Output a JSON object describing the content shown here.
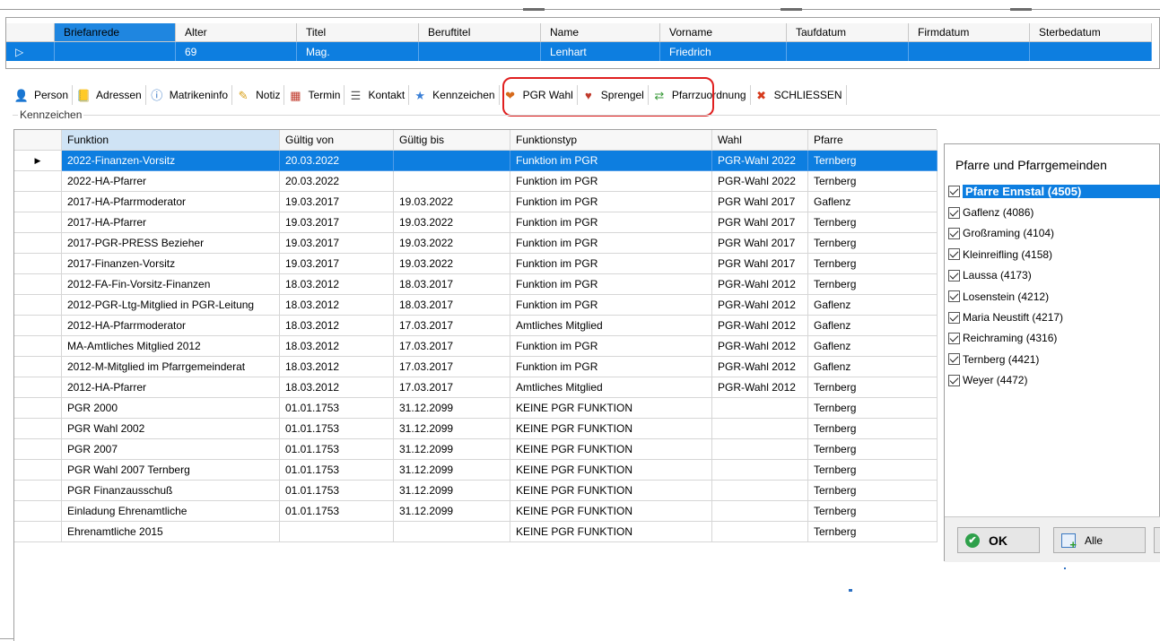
{
  "top_grid": {
    "headers": [
      "",
      "Briefanrede",
      "Alter",
      "Titel",
      "Beruftitel",
      "Name",
      "Vorname",
      "Taufdatum",
      "Firmdatum",
      "Sterbedatum"
    ],
    "row": [
      "▷",
      "",
      "69",
      "Mag.",
      "",
      "Lenhart",
      "Friedrich",
      "",
      "",
      ""
    ]
  },
  "tabs": [
    {
      "label": "Person",
      "icon": "person-icon",
      "glyph": "👤",
      "color": "#c46a1c"
    },
    {
      "label": "Adressen",
      "icon": "address-book-icon",
      "glyph": "📒",
      "color": "#c9a227"
    },
    {
      "label": "Matrikeninfo",
      "icon": "info-icon",
      "glyph": "ⓘ",
      "color": "#2b6fc2"
    },
    {
      "label": "Notiz",
      "icon": "note-icon",
      "glyph": "✎",
      "color": "#d9a11a"
    },
    {
      "label": "Termin",
      "icon": "calendar-icon",
      "glyph": "▦",
      "color": "#c0392b"
    },
    {
      "label": "Kontakt",
      "icon": "contact-icon",
      "glyph": "☰",
      "color": "#555555"
    },
    {
      "label": "Kennzeichen",
      "icon": "star-icon",
      "glyph": "★",
      "color": "#3a7fd6"
    },
    {
      "label": "PGR Wahl",
      "icon": "vote-icon",
      "glyph": "❤",
      "color": "#d66a1c"
    },
    {
      "label": "Sprengel",
      "icon": "sprengel-icon",
      "glyph": "♥",
      "color": "#c0392b"
    },
    {
      "label": "Pfarrzuordnung",
      "icon": "assign-arrows-icon",
      "glyph": "⇄",
      "color": "#3a9a3a"
    },
    {
      "label": "SCHLIESSEN",
      "icon": "close-icon",
      "glyph": "✖",
      "color": "#d63a1c"
    }
  ],
  "group_label": "Kennzeichen",
  "table": {
    "columns": [
      "Funktion",
      "Gültig von",
      "Gültig bis",
      "Funktionstyp",
      "Wahl",
      "Pfarre"
    ],
    "rows": [
      [
        "2022-Finanzen-Vorsitz",
        "20.03.2022",
        "",
        "Funktion im PGR",
        "PGR-Wahl 2022",
        "Ternberg"
      ],
      [
        "2022-HA-Pfarrer",
        "20.03.2022",
        "",
        "Funktion im PGR",
        "PGR-Wahl 2022",
        "Ternberg"
      ],
      [
        "2017-HA-Pfarrmoderator",
        "19.03.2017",
        "19.03.2022",
        "Funktion im PGR",
        "PGR Wahl 2017",
        "Gaflenz"
      ],
      [
        "2017-HA-Pfarrer",
        "19.03.2017",
        "19.03.2022",
        "Funktion im PGR",
        "PGR Wahl 2017",
        "Ternberg"
      ],
      [
        "2017-PGR-PRESS Bezieher",
        "19.03.2017",
        "19.03.2022",
        "Funktion im PGR",
        "PGR Wahl 2017",
        "Ternberg"
      ],
      [
        "2017-Finanzen-Vorsitz",
        "19.03.2017",
        "19.03.2022",
        "Funktion im PGR",
        "PGR Wahl 2017",
        "Ternberg"
      ],
      [
        "2012-FA-Fin-Vorsitz-Finanzen",
        "18.03.2012",
        "18.03.2017",
        "Funktion im PGR",
        "PGR-Wahl 2012",
        "Ternberg"
      ],
      [
        "2012-PGR-Ltg-Mitglied in PGR-Leitung",
        "18.03.2012",
        "18.03.2017",
        "Funktion im PGR",
        "PGR-Wahl 2012",
        "Gaflenz"
      ],
      [
        "2012-HA-Pfarrmoderator",
        "18.03.2012",
        "17.03.2017",
        "Amtliches Mitglied",
        "PGR-Wahl 2012",
        "Gaflenz"
      ],
      [
        "MA-Amtliches Mitglied 2012",
        "18.03.2012",
        "17.03.2017",
        "Funktion im PGR",
        "PGR-Wahl 2012",
        "Gaflenz"
      ],
      [
        "2012-M-Mitglied im Pfarrgemeinderat",
        "18.03.2012",
        "17.03.2017",
        "Funktion im PGR",
        "PGR-Wahl 2012",
        "Gaflenz"
      ],
      [
        "2012-HA-Pfarrer",
        "18.03.2012",
        "17.03.2017",
        "Amtliches Mitglied",
        "PGR-Wahl 2012",
        "Ternberg"
      ],
      [
        "PGR 2000",
        "01.01.1753",
        "31.12.2099",
        "KEINE PGR FUNKTION",
        "",
        "Ternberg"
      ],
      [
        "PGR Wahl 2002",
        "01.01.1753",
        "31.12.2099",
        "KEINE PGR FUNKTION",
        "",
        "Ternberg"
      ],
      [
        "PGR 2007",
        "01.01.1753",
        "31.12.2099",
        "KEINE PGR FUNKTION",
        "",
        "Ternberg"
      ],
      [
        "PGR Wahl 2007 Ternberg",
        "01.01.1753",
        "31.12.2099",
        "KEINE PGR FUNKTION",
        "",
        "Ternberg"
      ],
      [
        "PGR Finanzausschuß",
        "01.01.1753",
        "31.12.2099",
        "KEINE PGR FUNKTION",
        "",
        "Ternberg"
      ],
      [
        "Einladung Ehrenamtliche",
        "01.01.1753",
        "31.12.2099",
        "KEINE PGR FUNKTION",
        "",
        "Ternberg"
      ],
      [
        "Ehrenamtliche 2015",
        "",
        "",
        "KEINE PGR FUNKTION",
        "",
        "Ternberg"
      ]
    ],
    "selected_row": 0
  },
  "parish_panel": {
    "title": "Pfarre und Pfarrgemeinden",
    "items": [
      {
        "label": "Pfarre Ennstal (4505)",
        "checked": true
      },
      {
        "label": "Gaflenz (4086)",
        "checked": true
      },
      {
        "label": "Großraming (4104)",
        "checked": true
      },
      {
        "label": "Kleinreifling (4158)",
        "checked": true
      },
      {
        "label": "Laussa (4173)",
        "checked": true
      },
      {
        "label": "Losenstein (4212)",
        "checked": true
      },
      {
        "label": "Maria Neustift (4217)",
        "checked": true
      },
      {
        "label": "Reichraming (4316)",
        "checked": true
      },
      {
        "label": "Ternberg (4421)",
        "checked": true
      },
      {
        "label": "Weyer (4472)",
        "checked": true
      }
    ],
    "ok_label": "OK",
    "alle_label": "Alle"
  },
  "colors": {
    "selection": "#0d7ee0",
    "highlight_box": "#e01f1f"
  }
}
